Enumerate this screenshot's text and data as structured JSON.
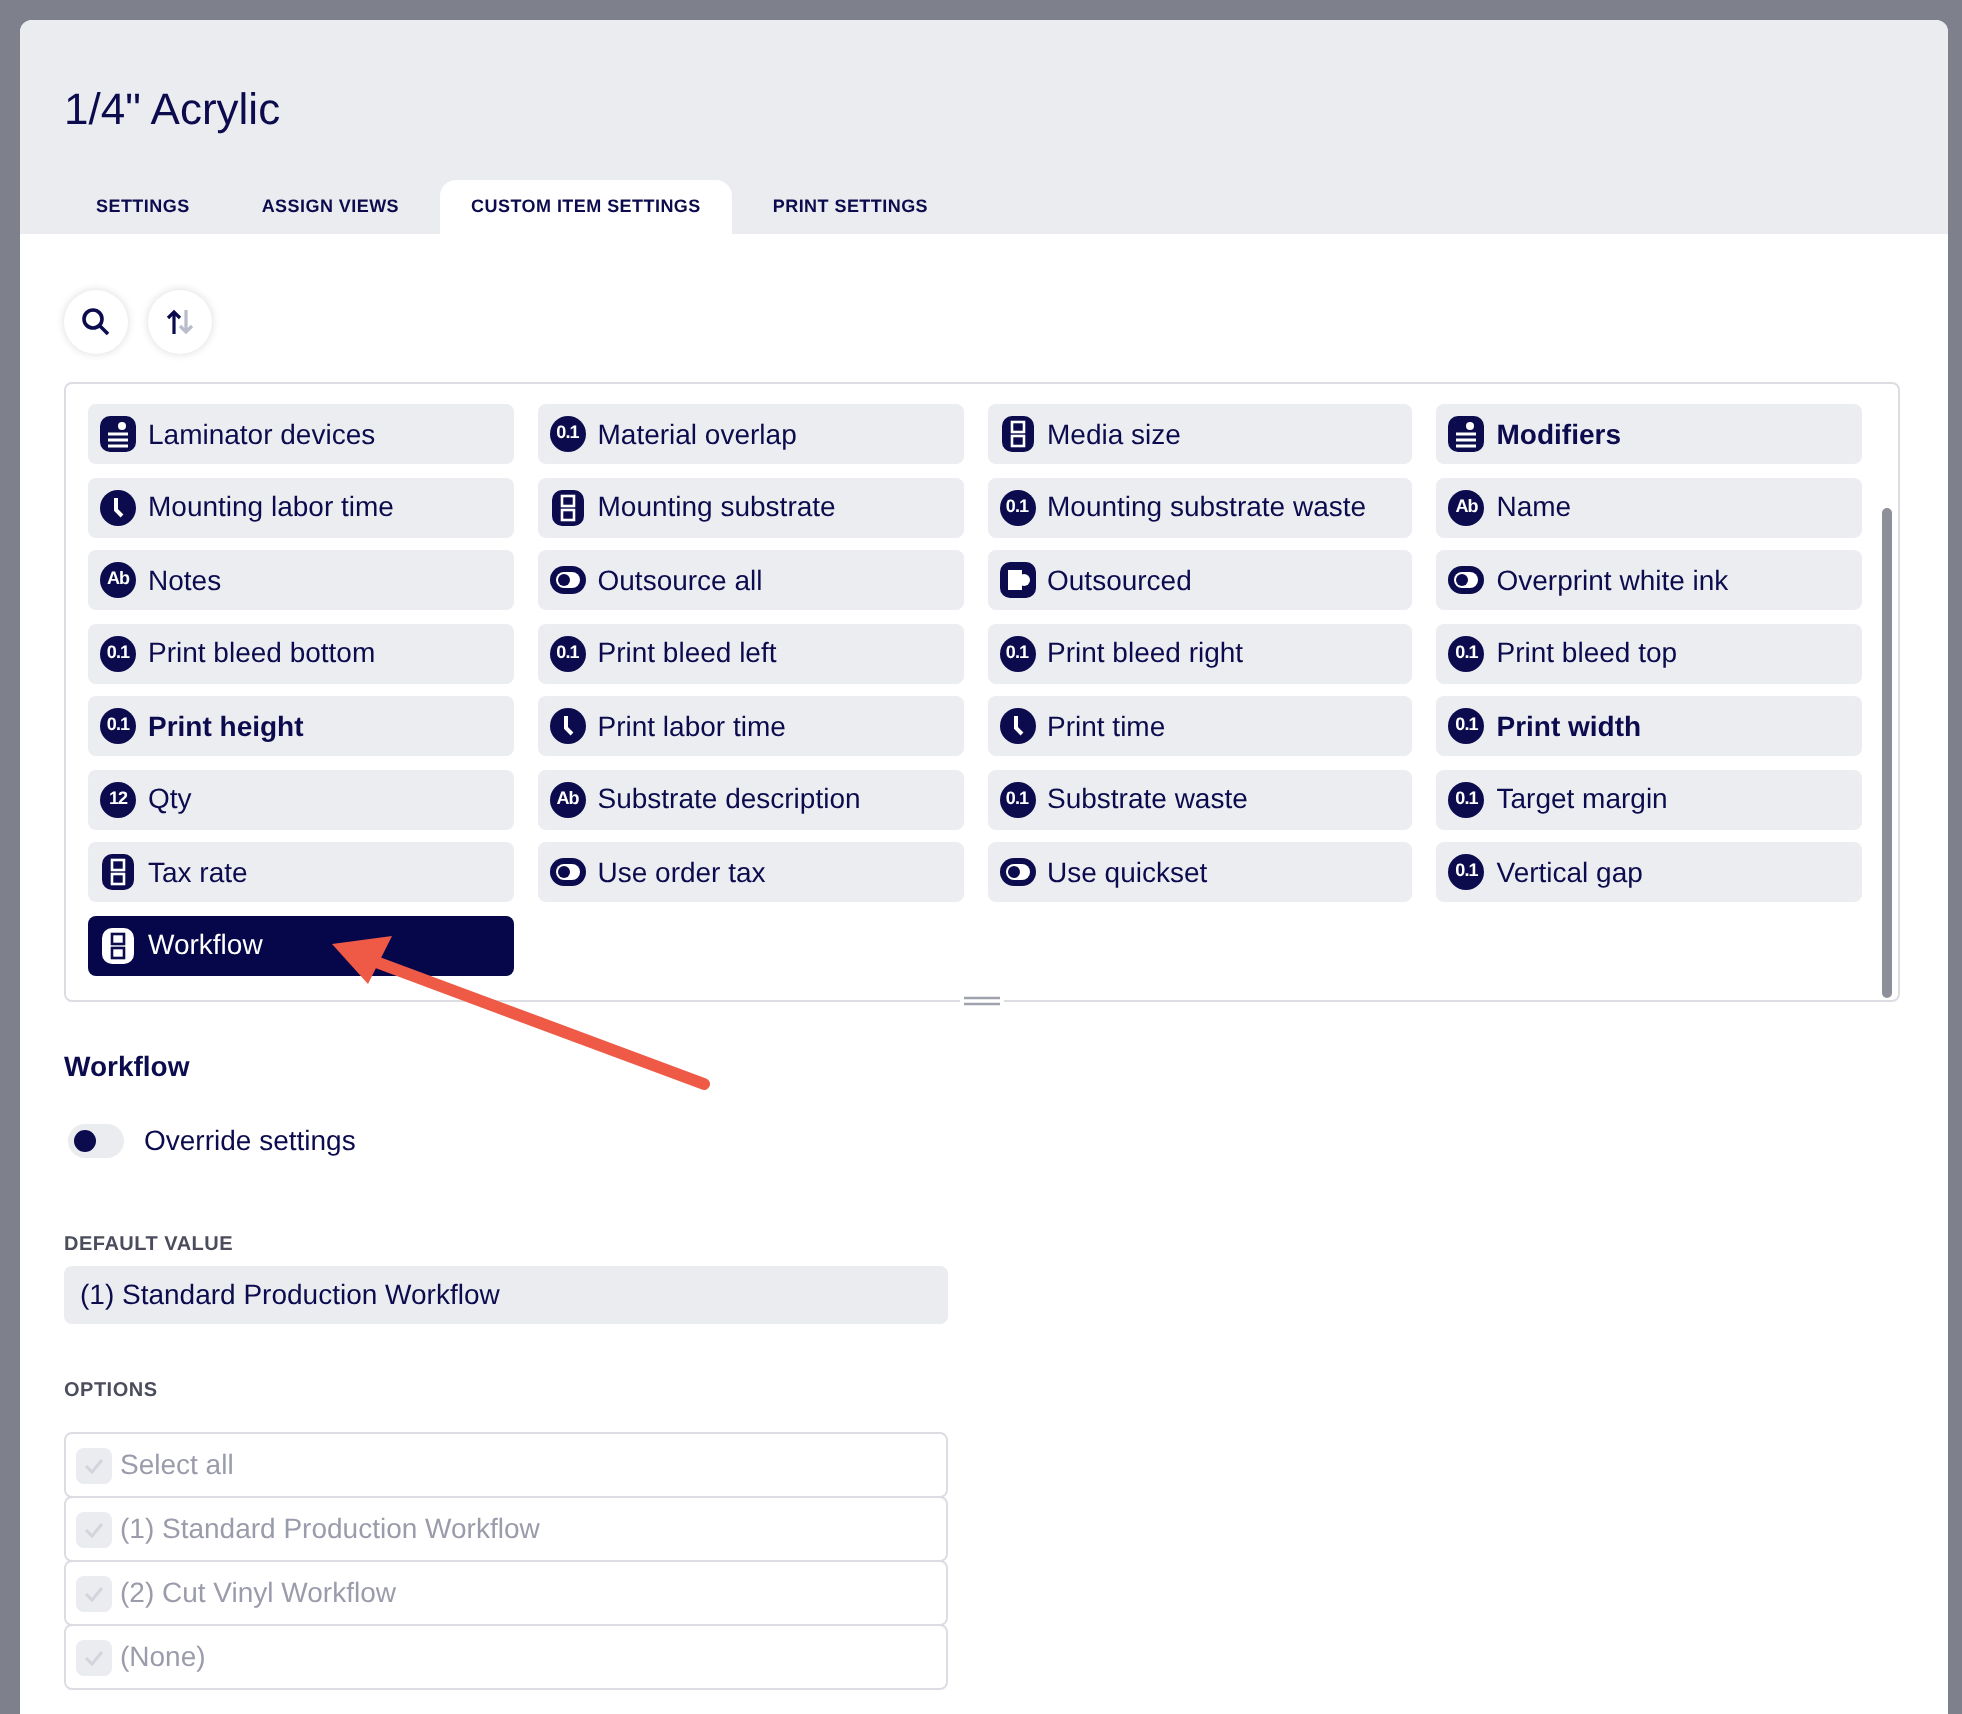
{
  "title": "1/4\" Acrylic",
  "tabs": [
    {
      "label": "SETTINGS",
      "selected": false
    },
    {
      "label": "ASSIGN VIEWS",
      "selected": false
    },
    {
      "label": "CUSTOM ITEM SETTINGS",
      "selected": true
    },
    {
      "label": "PRINT SETTINGS",
      "selected": false
    }
  ],
  "items": [
    {
      "label": "Laminator devices",
      "kind": "stack",
      "bold": false,
      "selected": false
    },
    {
      "label": "Material overlap",
      "kind": "number",
      "icon_text": "0.1",
      "bold": false,
      "selected": false
    },
    {
      "label": "Media size",
      "kind": "choice",
      "bold": false,
      "selected": false
    },
    {
      "label": "Modifiers",
      "kind": "stack",
      "bold": true,
      "selected": false
    },
    {
      "label": "Mounting labor time",
      "kind": "time",
      "bold": false,
      "selected": false
    },
    {
      "label": "Mounting substrate",
      "kind": "choice",
      "bold": false,
      "selected": false
    },
    {
      "label": "Mounting substrate waste",
      "kind": "number",
      "icon_text": "0.1",
      "bold": false,
      "selected": false
    },
    {
      "label": "Name",
      "kind": "number",
      "icon_text": "Ab",
      "bold": false,
      "selected": false
    },
    {
      "label": "Notes",
      "kind": "number",
      "icon_text": "Ab",
      "bold": false,
      "selected": false
    },
    {
      "label": "Outsource all",
      "kind": "toggle",
      "bold": false,
      "selected": false
    },
    {
      "label": "Outsourced",
      "kind": "outsourced",
      "bold": false,
      "selected": false
    },
    {
      "label": "Overprint white ink",
      "kind": "toggle",
      "bold": false,
      "selected": false
    },
    {
      "label": "Print bleed bottom",
      "kind": "number",
      "icon_text": "0.1",
      "bold": false,
      "selected": false
    },
    {
      "label": "Print bleed left",
      "kind": "number",
      "icon_text": "0.1",
      "bold": false,
      "selected": false
    },
    {
      "label": "Print bleed right",
      "kind": "number",
      "icon_text": "0.1",
      "bold": false,
      "selected": false
    },
    {
      "label": "Print bleed top",
      "kind": "number",
      "icon_text": "0.1",
      "bold": false,
      "selected": false
    },
    {
      "label": "Print height",
      "kind": "number",
      "icon_text": "0.1",
      "bold": true,
      "selected": false
    },
    {
      "label": "Print labor time",
      "kind": "time",
      "bold": false,
      "selected": false
    },
    {
      "label": "Print time",
      "kind": "time",
      "bold": false,
      "selected": false
    },
    {
      "label": "Print width",
      "kind": "number",
      "icon_text": "0.1",
      "bold": true,
      "selected": false
    },
    {
      "label": "Qty",
      "kind": "number",
      "icon_text": "12",
      "bold": false,
      "selected": false
    },
    {
      "label": "Substrate description",
      "kind": "number",
      "icon_text": "Ab",
      "bold": false,
      "selected": false
    },
    {
      "label": "Substrate waste",
      "kind": "number",
      "icon_text": "0.1",
      "bold": false,
      "selected": false
    },
    {
      "label": "Target margin",
      "kind": "number",
      "icon_text": "0.1",
      "bold": false,
      "selected": false
    },
    {
      "label": "Tax rate",
      "kind": "choice",
      "bold": false,
      "selected": false
    },
    {
      "label": "Use order tax",
      "kind": "toggle",
      "bold": false,
      "selected": false
    },
    {
      "label": "Use quickset",
      "kind": "toggle",
      "bold": false,
      "selected": false
    },
    {
      "label": "Vertical gap",
      "kind": "number",
      "icon_text": "0.1",
      "bold": false,
      "selected": false
    },
    {
      "label": "Workflow",
      "kind": "choice",
      "bold": false,
      "selected": true
    }
  ],
  "detail": {
    "heading": "Workflow",
    "override": {
      "label": "Override settings",
      "on": false
    },
    "default_value": {
      "label": "DEFAULT VALUE",
      "value": "(1) Standard Production Workflow"
    },
    "options_label": "OPTIONS",
    "options": [
      {
        "label": "Select all",
        "checked": true,
        "disabled": true
      },
      {
        "label": "(1) Standard Production Workflow",
        "checked": true,
        "disabled": true
      },
      {
        "label": "(2) Cut Vinyl Workflow",
        "checked": true,
        "disabled": true
      },
      {
        "label": "(None)",
        "checked": true,
        "disabled": true
      }
    ]
  }
}
